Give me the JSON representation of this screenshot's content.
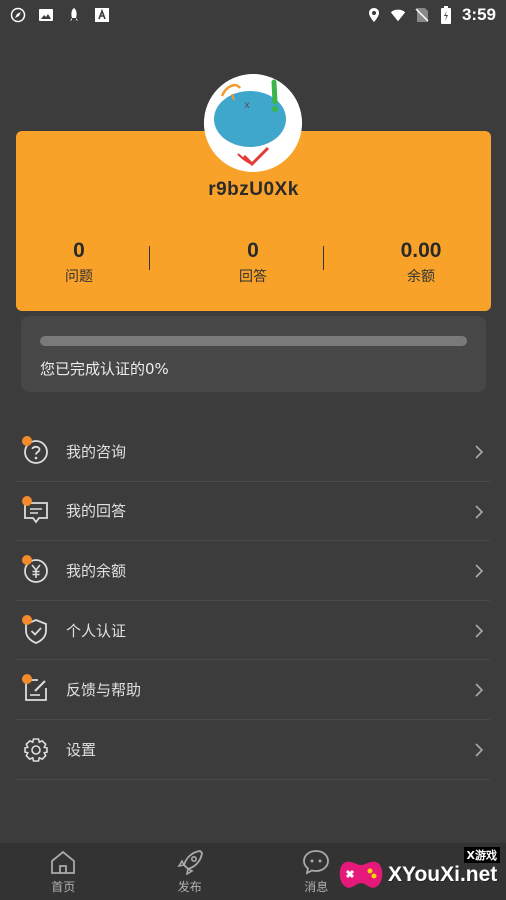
{
  "status_bar": {
    "time": "3:59",
    "icons": [
      "compass-icon",
      "image-icon",
      "rocket-icon",
      "a-icon",
      "location-icon",
      "wifi-icon",
      "sim-icon",
      "battery-icon"
    ]
  },
  "profile": {
    "username": "r9bzU0Xk",
    "stats": [
      {
        "value": "0",
        "label": "问题"
      },
      {
        "value": "0",
        "label": "回答"
      },
      {
        "value": "0.00",
        "label": "余额"
      }
    ]
  },
  "certification": {
    "progress_percent": 0,
    "text": "您已完成认证的0%"
  },
  "menu": [
    {
      "label": "我的咨询",
      "icon": "question-icon"
    },
    {
      "label": "我的回答",
      "icon": "message-icon"
    },
    {
      "label": "我的余额",
      "icon": "yuan-icon"
    },
    {
      "label": "个人认证",
      "icon": "shield-icon"
    },
    {
      "label": "反馈与帮助",
      "icon": "edit-icon"
    },
    {
      "label": "设置",
      "icon": "gear-icon"
    }
  ],
  "bottom_nav": [
    {
      "label": "首页",
      "icon": "home-icon"
    },
    {
      "label": "发布",
      "icon": "rocket-icon"
    },
    {
      "label": "消息",
      "icon": "chat-icon"
    },
    {
      "label": "",
      "icon": ""
    }
  ],
  "watermark": {
    "main": "XYouXi.net",
    "top": "X游戏"
  },
  "colors": {
    "accent": "#f9a229",
    "background": "#3c3c3c",
    "card": "#474747"
  }
}
